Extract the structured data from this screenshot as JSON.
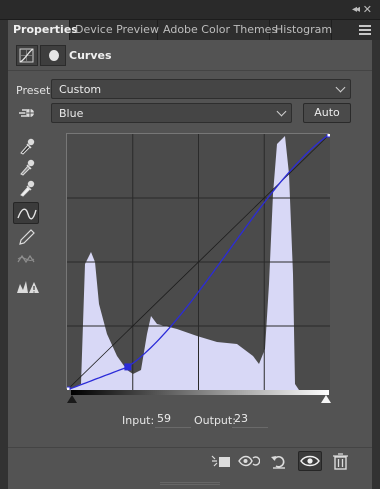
{
  "panel_tabs": [
    {
      "label": "Properties",
      "active": true
    },
    {
      "label": "Device Preview",
      "active": false
    },
    {
      "label": "Adobe Color Themes",
      "active": false
    },
    {
      "label": "Histogram",
      "active": false
    }
  ],
  "header": {
    "title": "Curves"
  },
  "preset": {
    "label": "Preset:",
    "value": "Custom"
  },
  "channel": {
    "value": "Blue"
  },
  "auto_button": {
    "label": "Auto"
  },
  "curve": {
    "channel": "Blue",
    "input_label": "Input:",
    "input_value": "59",
    "output_label": "Output:",
    "output_value": "23",
    "points": [
      [
        0,
        0
      ],
      [
        59,
        23
      ],
      [
        255,
        255
      ]
    ],
    "curve_color": "#2b2bd8",
    "histogram_color": "#d8d8f6"
  },
  "icons": {
    "left_tools": [
      "targeted-adjustment-icon",
      "black-point-eyedropper-icon",
      "gray-point-eyedropper-icon",
      "white-point-eyedropper-icon",
      "curve-points-icon",
      "pencil-icon",
      "smooth-icon",
      "clipping-warning-icon"
    ],
    "footer": [
      "clip-to-layer-icon",
      "view-previous-state-icon",
      "reset-icon",
      "visibility-icon",
      "delete-icon"
    ]
  }
}
